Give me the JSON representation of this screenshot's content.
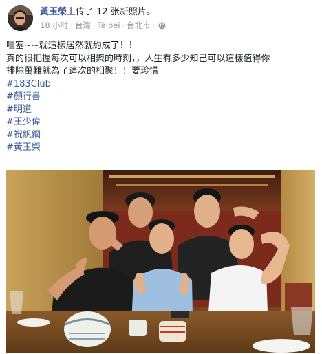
{
  "post": {
    "author_name": "黃玉榮",
    "action_text": "上传了 12 张新照片。",
    "time": "18 小时",
    "location_parts": [
      "台灣",
      "Taipei",
      "台北市"
    ],
    "separator": "·",
    "privacy_icon": "globe-icon",
    "text_lines": [
      "哇塞~~就這樣居然就約成了！！",
      "真的很把握每次可以相聚的時刻，，人生有多少知己可以這樣值得你",
      "排除萬難就為了這次的相聚！！要珍惜"
    ],
    "hashtags": [
      "#183Club",
      "#顏行書",
      "#明道",
      "#王少偉",
      "#祝釩鋼",
      "#黃玉榮"
    ]
  },
  "colors": {
    "link": "#365899",
    "meta": "#90949c",
    "text": "#1d2129"
  }
}
